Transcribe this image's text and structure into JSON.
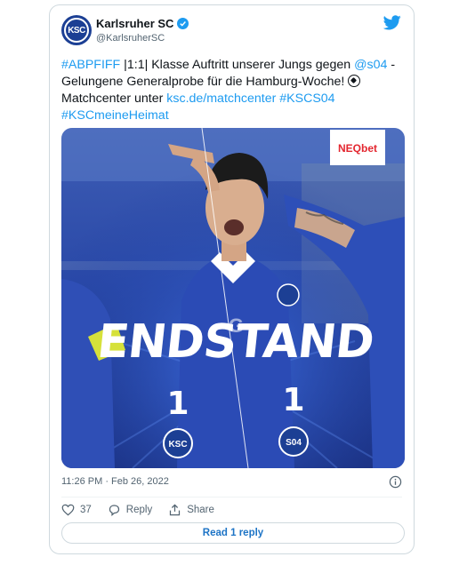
{
  "account": {
    "name": "Karlsruher SC",
    "handle": "@KarlsruherSC",
    "avatar_text": "KSC"
  },
  "tweet": {
    "parts": [
      {
        "text": "#ABPFIFF",
        "link": true
      },
      {
        "text": " |1:1| Klasse Auftritt unserer Jungs gegen ",
        "link": false
      },
      {
        "text": "@s04",
        "link": true
      },
      {
        "text": " - Gelungene Generalprobe für die Hamburg-Woche! ",
        "link": false
      },
      {
        "text": "Matchcenter unter ",
        "link": false
      },
      {
        "text": "ksc.de/matchcenter",
        "link": true
      },
      {
        "text": " ",
        "link": false
      },
      {
        "text": "#KSCS04",
        "link": true
      },
      {
        "text": "#KSCmeineHeimat",
        "link": true
      }
    ]
  },
  "media": {
    "sponsor": "NEQbet",
    "headline": "ENDSTAND",
    "home_score": "1",
    "away_score": "1",
    "home_badge": "KSC",
    "away_badge": "S04",
    "shirt_text": "G"
  },
  "timestamp": "11:26 PM · Feb 26, 2022",
  "actions": {
    "likes": "37",
    "reply_label": "Reply",
    "share_label": "Share"
  },
  "read_replies": "Read 1 reply",
  "colors": {
    "link": "#1d9bf0",
    "club_blue": "#1c3f94",
    "sponsor_red": "#e3262f"
  }
}
